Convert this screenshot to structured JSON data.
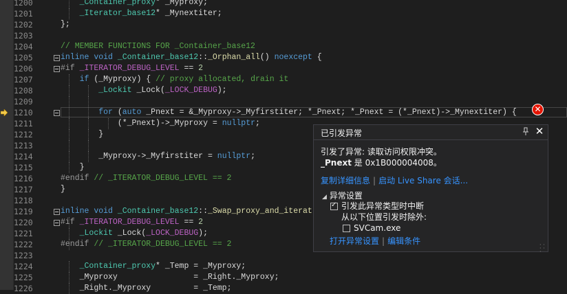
{
  "editor": {
    "lines": [
      {
        "num": "1200",
        "html": "    <span class=\"typ\">_Container_proxy</span>* <span class=\"var\">_Myproxy</span>;"
      },
      {
        "num": "1201",
        "html": "    <span class=\"typ\">_Iterator_base12</span>* <span class=\"var\">_Mynextiter</span>;"
      },
      {
        "num": "1202",
        "html": "};"
      },
      {
        "num": "1203",
        "html": ""
      },
      {
        "num": "1204",
        "html": "<span class=\"cm\">// MEMBER FUNCTIONS FOR _Container_base12</span>"
      },
      {
        "num": "1205",
        "html": "<span class=\"kw\">inline</span> <span class=\"kw\">void</span> <span class=\"typ\">_Container_base12</span>::<span class=\"fn\">_Orphan_all</span>() <span class=\"kw\">noexcept</span> {"
      },
      {
        "num": "1206",
        "html": "<span class=\"pp\">#if</span> <span class=\"mac\">_ITERATOR_DEBUG_LEVEL</span> == <span class=\"num\">2</span>"
      },
      {
        "num": "1207",
        "html": "    <span class=\"kw\">if</span> (<span class=\"var\">_Myproxy</span>) { <span class=\"cm\">// proxy allocated, drain it</span>"
      },
      {
        "num": "1208",
        "html": "        <span class=\"typ\">_Lockit</span> <span class=\"var\">_Lock</span>(<span class=\"mac\">_LOCK_DEBUG</span>);"
      },
      {
        "num": "1209",
        "html": ""
      },
      {
        "num": "1210",
        "html": "        <span class=\"kw\">for</span> (<span class=\"kw\">auto</span> <span class=\"var\">_Pnext</span> = &amp;<span class=\"var\">_Myproxy</span>-&gt;<span class=\"var\">_Myfirstiter</span>; *<span class=\"var\">_Pnext</span>; *<span class=\"var\">_Pnext</span> = (*<span class=\"var\">_Pnext</span>)-&gt;<span class=\"var\">_Mynextiter</span>) {"
      },
      {
        "num": "1211",
        "html": "            (*<span class=\"var\">_Pnext</span>)-&gt;<span class=\"var\">_Myproxy</span> = <span class=\"kw\">nullptr</span>;"
      },
      {
        "num": "1212",
        "html": "        }"
      },
      {
        "num": "1213",
        "html": ""
      },
      {
        "num": "1214",
        "html": "        <span class=\"var\">_Myproxy</span>-&gt;<span class=\"var\">_Myfirstiter</span> = <span class=\"kw\">nullptr</span>;"
      },
      {
        "num": "1215",
        "html": "    }"
      },
      {
        "num": "1216",
        "html": "<span class=\"pp\">#endif</span> <span class=\"cm\">// _ITERATOR_DEBUG_LEVEL == 2</span>"
      },
      {
        "num": "1217",
        "html": "}"
      },
      {
        "num": "1218",
        "html": ""
      },
      {
        "num": "1219",
        "html": "<span class=\"kw\">inline</span> <span class=\"kw\">void</span> <span class=\"typ\">_Container_base12</span>::<span class=\"fn\">_Swap_proxy_and_iterat</span>"
      },
      {
        "num": "1220",
        "html": "<span class=\"pp\">#if</span> <span class=\"mac\">_ITERATOR_DEBUG_LEVEL</span> == <span class=\"num\">2</span>"
      },
      {
        "num": "1221",
        "html": "    <span class=\"typ\">_Lockit</span> <span class=\"var\">_Lock</span>(<span class=\"mac\">_LOCK_DEBUG</span>);"
      },
      {
        "num": "1222",
        "html": "<span class=\"pp\">#endif</span> <span class=\"cm\">// _ITERATOR_DEBUG_LEVEL == 2</span>"
      },
      {
        "num": "1223",
        "html": ""
      },
      {
        "num": "1224",
        "html": "    <span class=\"typ\">_Container_proxy</span>* <span class=\"var\">_Temp</span> = <span class=\"var\">_Myproxy</span>;"
      },
      {
        "num": "1225",
        "html": "    <span class=\"var\">_Myproxy</span>                = <span class=\"var\">_Right</span>.<span class=\"var\">_Myproxy</span>;"
      },
      {
        "num": "1226",
        "html": "    <span class=\"var\">_Right</span>.<span class=\"var\">_Myproxy</span>         = <span class=\"var\">_Temp</span>;"
      }
    ]
  },
  "popup": {
    "title": "已引发异常",
    "message_line1": "引发了异常: 读取访问权限冲突。",
    "message_var": "_Pnext",
    "message_rest": " 是 0x1B000004008。",
    "link_copy": "复制详细信息",
    "link_liveshare": "启动 Live Share 会话...",
    "section_title": "异常设置",
    "opt_break": "引发此异常类型时中断",
    "opt_except": "从以下位置引发时除外:",
    "opt_module": "SVCam.exe",
    "link_open_settings": "打开异常设置",
    "link_edit_conditions": "编辑条件"
  },
  "colors": {
    "error": "#e51400",
    "link": "#3794ff",
    "keyword": "#569cd6",
    "comment": "#57a64a",
    "type": "#4ec9b0"
  }
}
